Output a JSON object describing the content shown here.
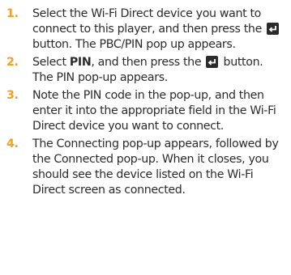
{
  "steps": [
    {
      "number": "1.",
      "t1": "Select the Wi-Fi Direct device you want to connect to this player, and then press the",
      "icon": "enter-button-icon",
      "t2": "button. The PBC/PIN pop up appears."
    },
    {
      "number": "2.",
      "t1": "Select",
      "bold": "PIN",
      "t2": ", and then press the",
      "icon": "enter-button-icon",
      "t3": "button. The PIN pop-up appears."
    },
    {
      "number": "3.",
      "text": "Note the PIN code in the pop-up, and then enter it into the appropriate field in the Wi-Fi Direct device you want to connect."
    },
    {
      "number": "4.",
      "text": "The Connecting pop-up appears, followed by the Connected pop-up. When it closes, you should see the device listed on the Wi-Fi Direct screen as connected."
    }
  ],
  "colors": {
    "step_number": "#f2a020",
    "body_text": "#2b2b2b",
    "icon_fill": "#2b2b2b"
  }
}
